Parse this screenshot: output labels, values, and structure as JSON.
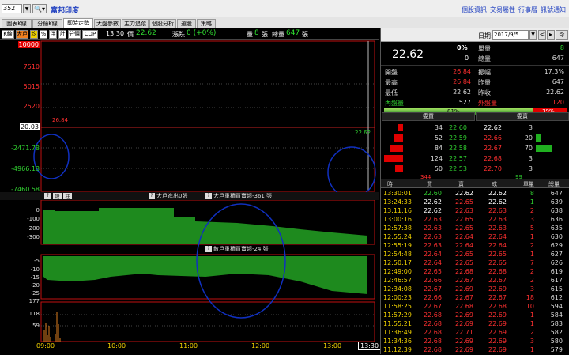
{
  "top": {
    "code": "352",
    "stock_name": "富邦印度",
    "links": [
      "個股資訊",
      "交易屬性",
      "行事曆",
      "訊號通知"
    ]
  },
  "tabs": [
    "圖表K線",
    "分鐘K線",
    "即時走勢",
    "大盤參數",
    "主力追蹤",
    "個股分析",
    "選股",
    "策略"
  ],
  "active_tab": 2,
  "toolbar": {
    "buttons": [
      "K線",
      "大戶",
      "均",
      "%",
      "泮",
      "計",
      "分價",
      "CDP"
    ],
    "time": "13:30",
    "price_label": "價",
    "price": "22.62",
    "change_label": "漲跌",
    "change": "0 (+0%)",
    "vol_label": "量",
    "vol": "8",
    "vol_unit": "張",
    "tvol_label": "總量",
    "tvol": "647",
    "tvol_unit": "張"
  },
  "chart": {
    "y_labels": [
      {
        "t": "10000",
        "c": "#fff",
        "bg": "#e00000"
      },
      {
        "t": "7510",
        "c": "#ff3030"
      },
      {
        "t": "5015",
        "c": "#ff3030"
      },
      {
        "t": "2520",
        "c": "#ff3030"
      },
      {
        "t": "20.03",
        "c": "#000",
        "bg": "#fff"
      },
      {
        "t": "-2471.78",
        "c": "#30d030"
      },
      {
        "t": "-4966.18",
        "c": "#30d030"
      },
      {
        "t": "-7460.58",
        "c": "#30d030"
      }
    ],
    "annot_left": "26.84",
    "annot_right": "22.62",
    "panel2_title": "大戶進出0張",
    "panel2_sub": "大戶重積買賣超-361 張",
    "panel2_btns": [
      "?",
      "說",
      "柱"
    ],
    "panel2_y": [
      "0",
      "-100",
      "-200",
      "-300"
    ],
    "panel3_title": "散戶重積買賣超-24 張",
    "panel3_y": [
      "-5",
      "-10",
      "-15",
      "-20",
      "-25"
    ],
    "panel4_y": [
      "177",
      "118",
      "59"
    ],
    "x_labels": [
      "09:00",
      "10:00",
      "11:00",
      "12:00",
      "13:00"
    ],
    "time_box": "13:30"
  },
  "right": {
    "date_label": "日期:",
    "date": "2017/9/5",
    "nav": [
      "<",
      "▸",
      "今"
    ],
    "big_price": "22.62",
    "pct": "0%",
    "chg": "0",
    "r_labels": {
      "unit": "單量",
      "total": "總量",
      "unit_v": "8",
      "total_v": "647"
    },
    "rows": [
      [
        {
          "l": "開盤",
          "v": "26.84",
          "c": "#ff3030"
        },
        {
          "l": "振幅",
          "v": "17.3%",
          "c": "#ddd"
        }
      ],
      [
        {
          "l": "最高",
          "v": "26.84",
          "c": "#ff3030"
        },
        {
          "l": "昨量",
          "v": "647",
          "c": "#ddd"
        }
      ],
      [
        {
          "l": "最低",
          "v": "22.62",
          "c": "#ddd"
        },
        {
          "l": "昨收",
          "v": "22.62",
          "c": "#ddd"
        }
      ],
      [
        {
          "l": "內盤量",
          "v": "527",
          "c": "#30d030"
        },
        {
          "l": "外盤量",
          "v": "120",
          "c": "#ff3030"
        }
      ]
    ],
    "ratio": {
      "buy": "81%",
      "sell": "19%",
      "buy_frac": 0.81
    },
    "ob_headers": [
      "委買",
      "委賣"
    ],
    "orderbook": [
      {
        "bq": "34",
        "bp": "22.60",
        "sp": "22.62",
        "sq": "3",
        "bw": 7,
        "sw": 0
      },
      {
        "bq": "52",
        "bp": "22.59",
        "sp": "22.66",
        "sq": "20",
        "bw": 11,
        "sw": 6
      },
      {
        "bq": "84",
        "bp": "22.58",
        "sp": "22.67",
        "sq": "70",
        "bw": 16,
        "sw": 20
      },
      {
        "bq": "124",
        "bp": "22.57",
        "sp": "22.68",
        "sq": "3",
        "bw": 24,
        "sw": 0
      },
      {
        "bq": "50",
        "bp": "22.53",
        "sp": "22.70",
        "sq": "3",
        "bw": 10,
        "sw": 0
      }
    ],
    "ob_totals": {
      "buy": "344",
      "sell": "99"
    },
    "trade_headers": [
      "時",
      "買",
      "賣",
      "成",
      "單量",
      "總量"
    ],
    "trades": [
      [
        "13:30:01",
        "22.60",
        "22.62",
        "22.62",
        "8",
        "647"
      ],
      [
        "13:24:33",
        "22.62",
        "22.65",
        "22.62",
        "1",
        "639"
      ],
      [
        "13:11:16",
        "22.62",
        "22.63",
        "22.63",
        "2",
        "638"
      ],
      [
        "13:00:16",
        "22.63",
        "22.65",
        "22.63",
        "3",
        "636"
      ],
      [
        "12:57:38",
        "22.63",
        "22.65",
        "22.63",
        "5",
        "635"
      ],
      [
        "12:55:24",
        "22.63",
        "22.64",
        "22.64",
        "1",
        "630"
      ],
      [
        "12:55:19",
        "22.63",
        "22.64",
        "22.64",
        "2",
        "629"
      ],
      [
        "12:54:48",
        "22.64",
        "22.65",
        "22.65",
        "1",
        "627"
      ],
      [
        "12:50:17",
        "22.64",
        "22.65",
        "22.65",
        "7",
        "626"
      ],
      [
        "12:49:00",
        "22.65",
        "22.68",
        "22.68",
        "2",
        "619"
      ],
      [
        "12:46:57",
        "22.66",
        "22.67",
        "22.67",
        "2",
        "617"
      ],
      [
        "12:34:08",
        "22.67",
        "22.69",
        "22.69",
        "3",
        "615"
      ],
      [
        "12:00:23",
        "22.66",
        "22.67",
        "22.67",
        "18",
        "612"
      ],
      [
        "11:58:25",
        "22.67",
        "22.68",
        "22.68",
        "10",
        "594"
      ],
      [
        "11:57:29",
        "22.68",
        "22.69",
        "22.69",
        "1",
        "584"
      ],
      [
        "11:55:21",
        "22.68",
        "22.69",
        "22.69",
        "1",
        "583"
      ],
      [
        "11:36:49",
        "22.68",
        "22.71",
        "22.69",
        "2",
        "582"
      ],
      [
        "11:34:36",
        "22.68",
        "22.69",
        "22.69",
        "3",
        "580"
      ],
      [
        "11:12:39",
        "22.68",
        "22.69",
        "22.69",
        "1",
        "579"
      ]
    ]
  }
}
